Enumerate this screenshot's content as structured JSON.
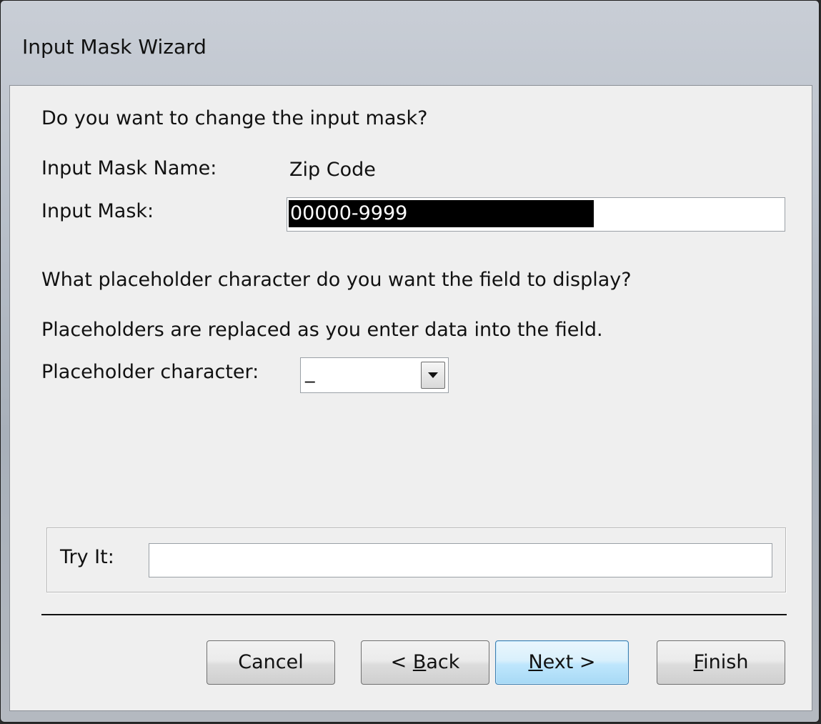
{
  "window": {
    "title": "Input Mask Wizard"
  },
  "wizard": {
    "question": "Do you want to change the input mask?",
    "mask_name_label": "Input Mask Name:",
    "mask_name_value": "Zip Code",
    "input_mask_label": "Input Mask:",
    "input_mask_value": "00000-9999",
    "placeholder_question": "What placeholder character do you want the field to display?",
    "placeholder_note": "Placeholders are replaced as you enter data into the field.",
    "placeholder_label": "Placeholder character:",
    "placeholder_value": "_",
    "try_it_label": "Try It:",
    "try_it_value": ""
  },
  "buttons": {
    "cancel": "Cancel",
    "back_prefix": "< ",
    "back_mnemonic": "B",
    "back_rest": "ack",
    "next_mnemonic": "N",
    "next_rest": "ext >",
    "finish_mnemonic": "F",
    "finish_rest": "inish"
  },
  "icons": {
    "dropdown": "chevron-down-icon"
  }
}
